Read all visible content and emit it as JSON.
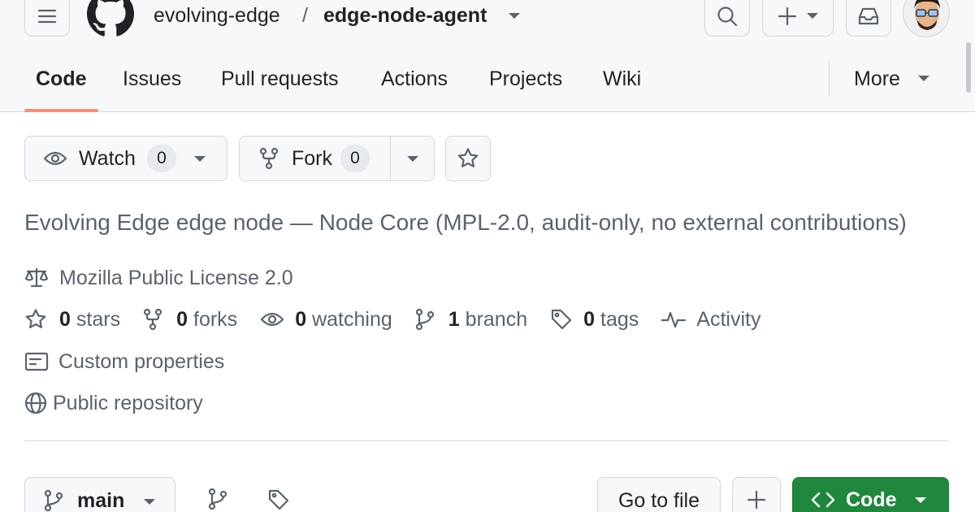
{
  "header": {
    "owner": "evolving-edge",
    "separator": "/",
    "repo": "edge-node-agent"
  },
  "nav": {
    "tabs": [
      {
        "label": "Code",
        "selected": true
      },
      {
        "label": "Issues"
      },
      {
        "label": "Pull requests"
      },
      {
        "label": "Actions"
      },
      {
        "label": "Projects"
      },
      {
        "label": "Wiki"
      }
    ],
    "more_label": "More"
  },
  "actions": {
    "watch_label": "Watch",
    "watch_count": "0",
    "fork_label": "Fork",
    "fork_count": "0"
  },
  "about": {
    "description": "Evolving Edge edge node — Node Core (MPL-2.0, audit-only, no external contributions)",
    "license": "Mozilla Public License 2.0",
    "stars_count": "0",
    "stars_label": "stars",
    "forks_count": "0",
    "forks_label": "forks",
    "watching_count": "0",
    "watching_label": "watching",
    "branch_count": "1",
    "branch_label": "branch",
    "tags_count": "0",
    "tags_label": "tags",
    "activity_label": "Activity",
    "custom_properties_label": "Custom properties",
    "visibility_label": "Public repository"
  },
  "file_nav": {
    "branch_name": "main",
    "go_to_file_label": "Go to file",
    "code_button_label": "Code"
  },
  "colors": {
    "accent_underline": "#fd8c73",
    "code_button_bg": "#1f883d",
    "header_bg": "#f6f8fa"
  },
  "icons": [
    "hamburger-icon",
    "github-logo-icon",
    "search-icon",
    "plus-icon",
    "inbox-icon",
    "avatar",
    "eye-icon",
    "fork-icon",
    "star-icon",
    "law-icon",
    "pulse-icon",
    "note-icon",
    "globe-icon",
    "branch-icon",
    "tag-icon",
    "code-brackets-icon"
  ]
}
